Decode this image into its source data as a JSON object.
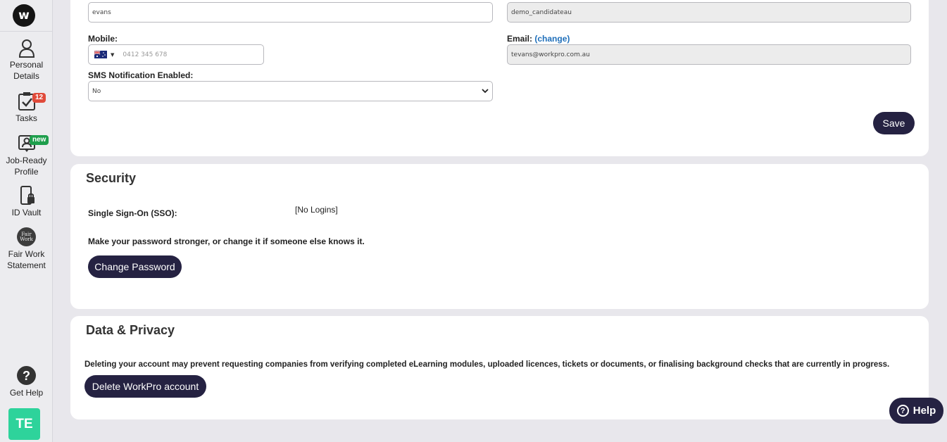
{
  "sidebar": {
    "logo": "w",
    "items": [
      {
        "label1": "Personal",
        "label2": "Details",
        "icon": "person-icon"
      },
      {
        "label1": "Tasks",
        "label2": "",
        "icon": "tasks-checkbox-icon",
        "badge": "12"
      },
      {
        "label1": "Job-Ready",
        "label2": "Profile",
        "icon": "profile-card-icon",
        "badge": "new"
      },
      {
        "label1": "ID Vault",
        "label2": "",
        "icon": "phone-lock-icon"
      },
      {
        "label1": "Fair Work",
        "label2": "Statement",
        "icon": "fair-work-logo-icon",
        "icon_text1": "Fair",
        "icon_text2": "Work"
      }
    ],
    "help": {
      "label": "Get Help",
      "glyph": "?"
    },
    "avatar": "TE"
  },
  "personal": {
    "surname_value": "evans",
    "username_value": "demo_candidateau",
    "mobile_label": "Mobile:",
    "mobile_placeholder": "0412 345 678",
    "email_label": "Email:",
    "email_change": "(change)",
    "email_value": "tevans@workpro.com.au",
    "sms_label": "SMS Notification Enabled:",
    "sms_value": "No",
    "save_label": "Save"
  },
  "security": {
    "title": "Security",
    "sso_label": "Single Sign-On (SSO):",
    "sso_value": "[No Logins]",
    "password_text": "Make your password stronger, or change it if someone else knows it.",
    "change_password_label": "Change Password"
  },
  "privacy": {
    "title": "Data & Privacy",
    "delete_text": "Deleting your account may prevent requesting companies from verifying completed eLearning modules, uploaded licences, tickets or documents, or finalising background checks that are currently in progress.",
    "delete_label": "Delete WorkPro account"
  },
  "help_widget": {
    "label": "Help",
    "glyph": "?"
  },
  "colors": {
    "primary_button": "#252242",
    "avatar": "#2ed39b",
    "badge_red": "#e04b3b",
    "badge_green": "#1e9e4c",
    "link": "#1f6fba"
  }
}
